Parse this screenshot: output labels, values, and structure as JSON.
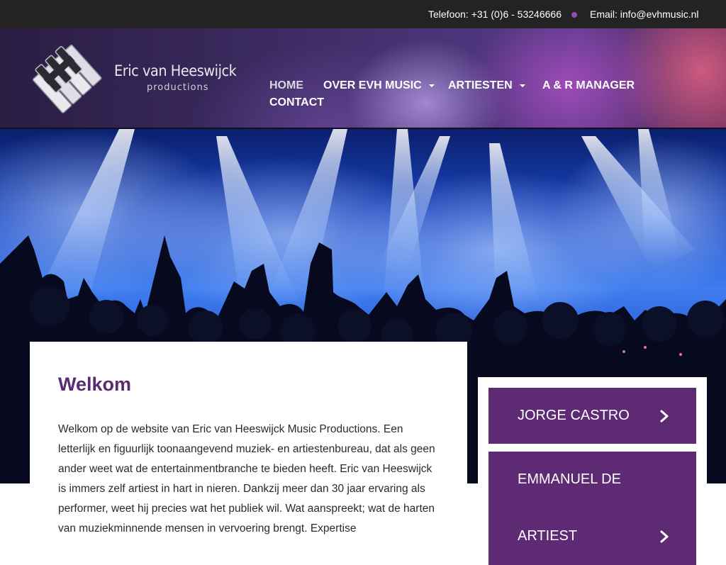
{
  "topbar": {
    "phone": "Telefoon: +31 (0)6 - 53246666",
    "email": "Email: info@evhmusic.nl"
  },
  "logo": {
    "name": "Eric van Heeswijck",
    "subtitle": "productions"
  },
  "nav": {
    "items": [
      {
        "label": "HOME",
        "active": true,
        "dropdown": false
      },
      {
        "label": "OVER EVH MUSIC",
        "active": false,
        "dropdown": true
      },
      {
        "label": "ARTIESTEN",
        "active": false,
        "dropdown": true
      },
      {
        "label": "A & R MANAGER",
        "active": false,
        "dropdown": false
      },
      {
        "label": "CONTACT",
        "active": false,
        "dropdown": false
      }
    ]
  },
  "welcome": {
    "title": "Welkom",
    "body": "Welkom op de website van Eric van Heeswijck Music Productions. Een letterlijk en figuurlijk toonaangevend muziek- en artiestenbureau, dat als geen ander weet wat de entertainmentbranche te bieden heeft. Eric van Heeswijck is immers zelf artiest in hart in nieren. Dankzij meer dan 30  jaar ervaring als performer, weet hij precies wat het publiek wil. Wat aanspreekt; wat de harten van muziekminnende mensen in vervoering brengt. Expertise"
  },
  "artists": {
    "cards": [
      {
        "label": "JORGE CASTRO"
      },
      {
        "label": "EMMANUEL DE"
      },
      {
        "label": "ARTIEST"
      }
    ]
  },
  "colors": {
    "topbar_bg": "#232323",
    "accent_purple": "#5d2a73",
    "title_purple": "#5a2a72",
    "dot": "#8f4fb0"
  },
  "icons": {
    "chevron": "chevron-right-icon",
    "caret": "caret-down-icon"
  }
}
